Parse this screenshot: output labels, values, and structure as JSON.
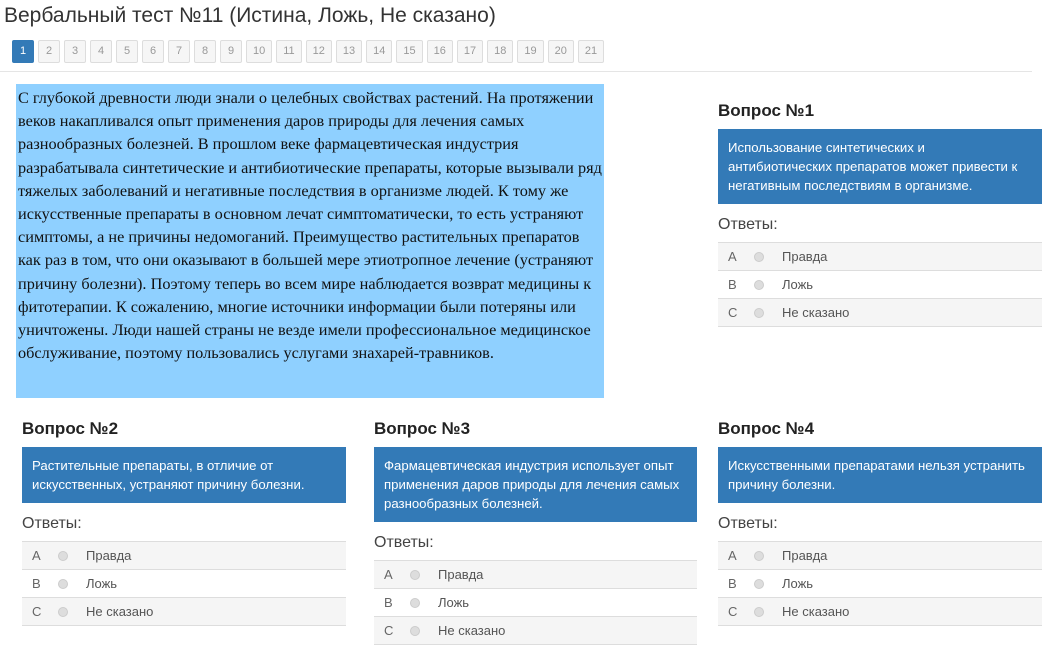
{
  "title": "Вербальный тест №11 (Истина, Ложь, Не сказано)",
  "pages": [
    "1",
    "2",
    "3",
    "4",
    "5",
    "6",
    "7",
    "8",
    "9",
    "10",
    "11",
    "12",
    "13",
    "14",
    "15",
    "16",
    "17",
    "18",
    "19",
    "20",
    "21"
  ],
  "active_page": "1",
  "passage": "С глубокой древности люди знали о целебных свойствах растений. На протяжении веков накапливался опыт применения даров природы для лечения самых разнообразных болезней. В прошлом веке фармацевтическая индустрия разрабатывала синтетические и антибиотические препараты, которые вызывали ряд тяжелых заболеваний и негативные последствия в организме людей. К тому же искусственные препараты в основном лечат симптоматически, то есть устраняют симптомы, а не причины недомоганий. Преимущество растительных препаратов как раз в том, что они оказывают в большей мере этиотропное лечение (устраняют причину болезни). Поэтому теперь во всем мире наблюдается возврат медицины к фитотерапии. К сожалению, многие источники информации были потеряны или уничтожены. Люди нашей страны не везде имели профессиональное медицинское обслуживание, поэтому пользовались услугами знахарей-травников.",
  "answers_label": "Ответы:",
  "answer_options": [
    {
      "letter": "A",
      "text": "Правда"
    },
    {
      "letter": "B",
      "text": "Ложь"
    },
    {
      "letter": "C",
      "text": "Не сказано"
    }
  ],
  "questions": [
    {
      "title": "Вопрос №1",
      "text": "Использование синтетических и антибиотических препаратов может привести к негативным последствиям в организме."
    },
    {
      "title": "Вопрос №2",
      "text": "Растительные препараты, в отличие от искусственных, устраняют причину болезни."
    },
    {
      "title": "Вопрос №3",
      "text": "Фармацевтическая индустрия использует опыт применения даров природы для лечения самых разнообразных болезней."
    },
    {
      "title": "Вопрос №4",
      "text": "Искусственными препаратами нельзя устранить причину болезни."
    }
  ],
  "colors": {
    "accent": "#337ab7",
    "passage_bg": "#8fd0ff"
  }
}
